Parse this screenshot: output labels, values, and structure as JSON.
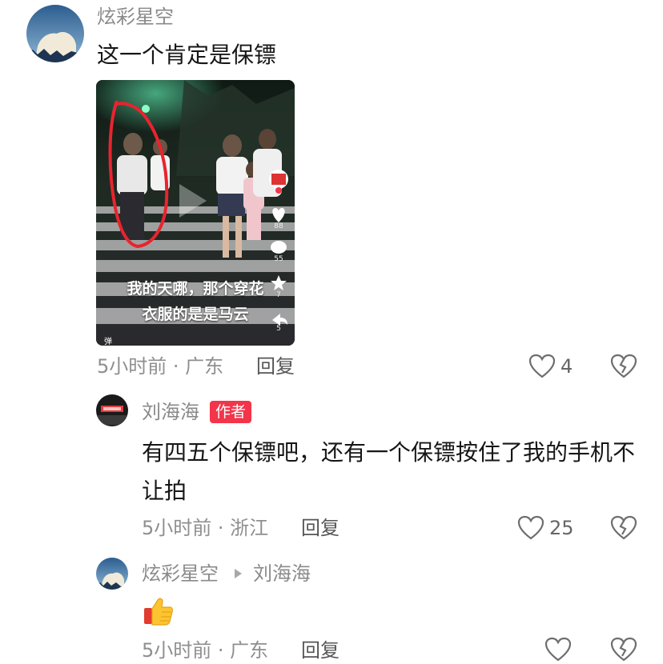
{
  "comments": [
    {
      "username": "炫彩星空",
      "text": "这一个肯定是保镖",
      "time_location": "5小时前 · 广东",
      "reply_label": "回复",
      "like_count": "4",
      "video": {
        "caption_line1": "我的天哪，那个穿花",
        "caption_line2": "衣服的是是马云",
        "side_like_count": "88",
        "side_comment_count": "55",
        "side_fav_count": "7",
        "side_share_count": "5",
        "danmu_label": "弹"
      }
    },
    {
      "username": "刘海海",
      "author_badge": "作者",
      "text": "有四五个保镖吧，还有一个保镖按住了我的手机不让拍",
      "time_location": "5小时前 · 浙江",
      "reply_label": "回复",
      "like_count": "25"
    },
    {
      "username": "炫彩星空",
      "reply_to": "刘海海",
      "text_emoji": "thumbs-up-emoji",
      "time_location": "5小时前 · 广东",
      "reply_label": "回复",
      "like_count": ""
    }
  ],
  "colors": {
    "badge_red": "#f2354a",
    "annotation_red": "#e8242e",
    "meta_gray": "#8f8f8f"
  }
}
